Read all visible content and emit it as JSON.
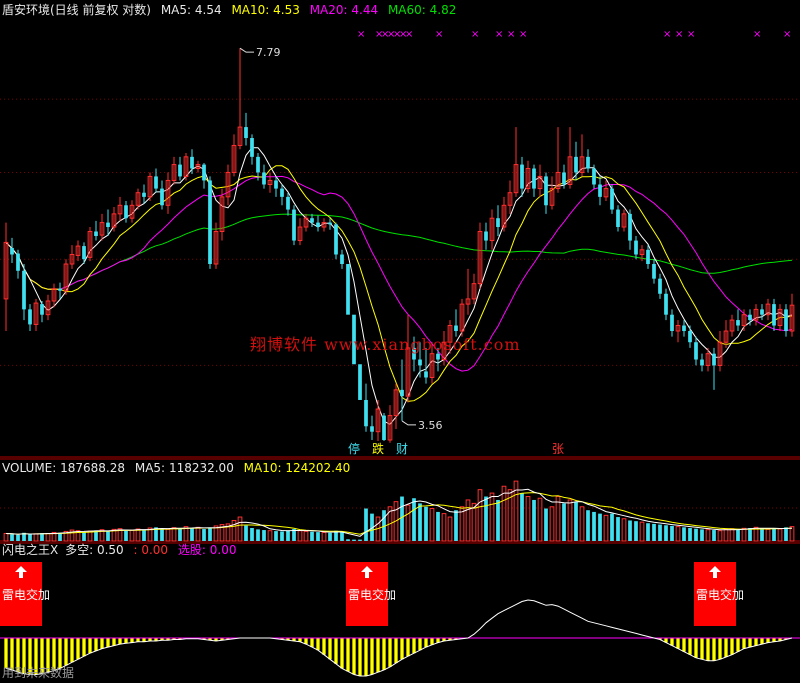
{
  "header": {
    "title": "盾安环境(日线 前复权 对数)",
    "ma5_label": "MA5:",
    "ma5_value": "4.54",
    "ma10_label": "MA10:",
    "ma10_value": "4.53",
    "ma20_label": "MA20:",
    "ma20_value": "4.44",
    "ma60_label": "MA60:",
    "ma60_value": "4.82"
  },
  "volume_header": {
    "label": "VOLUME:",
    "value": "187688.28",
    "ma5_label": "MA5:",
    "ma5_value": "118232.00",
    "ma10_label": "MA10:",
    "ma10_value": "124202.40"
  },
  "indicator_header": {
    "name": "闪电之王X",
    "duokong_label": "多空:",
    "duokong_value": "0.50",
    "extra_value": ": 0.00",
    "xuangu_label": "选股:",
    "xuangu_value": "0.00"
  },
  "watermark": "翔博软件  www.xiangbosoft.com",
  "footer": "用到未来数据",
  "colors": {
    "up": "#ff3030",
    "down": "#40e0f0",
    "ma5": "#ffffff",
    "ma10": "#ffff00",
    "ma20": "#ff00ff",
    "ma60": "#00e000",
    "grid": "#7a0000",
    "signal_box": "#ff0000",
    "histogram": "#ffff00"
  },
  "chart_data": [
    {
      "type": "candlestick",
      "panel": "price",
      "y_scale": "log",
      "ylim": [
        3.3,
        8.3
      ],
      "annotations": [
        {
          "text": "7.79",
          "bar": 39,
          "price": 7.79
        },
        {
          "text": "3.56",
          "bar": 66,
          "price": 3.56
        }
      ],
      "markers": [
        {
          "text": "停",
          "bar": 58,
          "color": "#40e0f0"
        },
        {
          "text": "跌",
          "bar": 62,
          "color": "#ffff00"
        },
        {
          "text": "财",
          "bar": 66,
          "color": "#40e0f0"
        },
        {
          "text": "张",
          "bar": 92,
          "color": "#ff3030"
        }
      ],
      "top_marks": {
        "symbol": "×",
        "bars": [
          59,
          62,
          63,
          64,
          65,
          66,
          67,
          72,
          78,
          82,
          84,
          86,
          110,
          112,
          114,
          125,
          130
        ]
      },
      "candles": [
        [
          4.6,
          5.18,
          4.3,
          5.4
        ],
        [
          5.12,
          5.05,
          4.96,
          5.23
        ],
        [
          5.06,
          4.88,
          4.8,
          5.1
        ],
        [
          4.88,
          4.5,
          4.4,
          4.95
        ],
        [
          4.5,
          4.36,
          4.3,
          4.55
        ],
        [
          4.36,
          4.56,
          4.3,
          4.6
        ],
        [
          4.55,
          4.45,
          4.38,
          4.58
        ],
        [
          4.45,
          4.58,
          4.4,
          4.64
        ],
        [
          4.58,
          4.7,
          4.52,
          4.75
        ],
        [
          4.7,
          4.68,
          4.6,
          4.76
        ],
        [
          4.68,
          4.95,
          4.64,
          5.0
        ],
        [
          4.95,
          5.05,
          4.9,
          5.15
        ],
        [
          5.04,
          5.14,
          4.98,
          5.2
        ],
        [
          5.14,
          5.0,
          4.95,
          5.18
        ],
        [
          5.02,
          5.3,
          4.98,
          5.35
        ],
        [
          5.3,
          5.25,
          5.2,
          5.42
        ],
        [
          5.26,
          5.4,
          5.2,
          5.5
        ],
        [
          5.4,
          5.35,
          5.25,
          5.55
        ],
        [
          5.35,
          5.5,
          5.3,
          5.58
        ],
        [
          5.5,
          5.6,
          5.42,
          5.7
        ],
        [
          5.6,
          5.45,
          5.4,
          5.65
        ],
        [
          5.45,
          5.6,
          5.4,
          5.66
        ],
        [
          5.6,
          5.75,
          5.55,
          5.8
        ],
        [
          5.75,
          5.7,
          5.62,
          5.85
        ],
        [
          5.7,
          5.95,
          5.65,
          6.0
        ],
        [
          5.95,
          5.8,
          5.75,
          6.05
        ],
        [
          5.8,
          5.6,
          5.55,
          5.9
        ],
        [
          5.6,
          5.9,
          5.5,
          6.0
        ],
        [
          5.9,
          6.1,
          5.85,
          6.2
        ],
        [
          6.1,
          5.95,
          5.9,
          6.2
        ],
        [
          5.95,
          6.2,
          5.9,
          6.25
        ],
        [
          6.2,
          6.05,
          5.98,
          6.3
        ],
        [
          6.05,
          6.1,
          6.0,
          6.15
        ],
        [
          6.1,
          5.9,
          5.8,
          6.12
        ],
        [
          5.9,
          4.95,
          4.9,
          5.95
        ],
        [
          4.95,
          5.3,
          4.9,
          5.4
        ],
        [
          5.3,
          5.7,
          5.2,
          5.8
        ],
        [
          5.7,
          6.0,
          5.6,
          6.1
        ],
        [
          6.0,
          6.35,
          5.95,
          6.5
        ],
        [
          6.35,
          6.6,
          6.3,
          7.79
        ],
        [
          6.6,
          6.45,
          6.35,
          6.8
        ],
        [
          6.45,
          6.2,
          6.1,
          6.5
        ],
        [
          6.2,
          6.0,
          5.9,
          6.25
        ],
        [
          6.0,
          5.85,
          5.8,
          6.1
        ],
        [
          5.85,
          5.9,
          5.75,
          6.0
        ],
        [
          5.9,
          5.8,
          5.7,
          5.95
        ],
        [
          5.8,
          5.7,
          5.6,
          5.85
        ],
        [
          5.7,
          5.55,
          5.48,
          5.75
        ],
        [
          5.55,
          5.2,
          5.15,
          5.6
        ],
        [
          5.2,
          5.35,
          5.15,
          5.45
        ],
        [
          5.35,
          5.45,
          5.3,
          5.5
        ],
        [
          5.45,
          5.4,
          5.35,
          5.5
        ],
        [
          5.4,
          5.35,
          5.3,
          5.48
        ],
        [
          5.35,
          5.4,
          5.3,
          5.45
        ],
        [
          5.4,
          5.38,
          5.32,
          5.45
        ],
        [
          5.38,
          5.05,
          5.0,
          5.4
        ],
        [
          5.05,
          4.95,
          4.9,
          5.1
        ],
        [
          4.95,
          4.45,
          4.45,
          4.45
        ],
        [
          4.45,
          4.01,
          4.01,
          4.01
        ],
        [
          4.01,
          3.72,
          3.72,
          3.72
        ],
        [
          3.72,
          3.52,
          3.48,
          3.85
        ],
        [
          3.52,
          3.48,
          3.42,
          3.6
        ],
        [
          3.48,
          3.65,
          3.4,
          3.72
        ],
        [
          3.6,
          3.42,
          3.38,
          3.62
        ],
        [
          3.42,
          3.6,
          3.4,
          3.68
        ],
        [
          3.6,
          3.8,
          3.5,
          3.85
        ],
        [
          3.8,
          3.75,
          3.56,
          4.05
        ],
        [
          3.75,
          4.15,
          3.7,
          4.45
        ],
        [
          4.15,
          4.05,
          3.95,
          4.25
        ],
        [
          4.05,
          4.0,
          3.9,
          4.2
        ],
        [
          3.95,
          3.9,
          3.85,
          4.15
        ],
        [
          3.9,
          4.1,
          3.85,
          4.2
        ],
        [
          4.1,
          4.05,
          3.95,
          4.15
        ],
        [
          4.05,
          4.2,
          4.0,
          4.3
        ],
        [
          4.2,
          4.35,
          4.1,
          4.4
        ],
        [
          4.35,
          4.3,
          4.25,
          4.5
        ],
        [
          4.3,
          4.55,
          4.25,
          4.6
        ],
        [
          4.55,
          4.6,
          4.45,
          4.9
        ],
        [
          4.6,
          4.75,
          4.55,
          4.85
        ],
        [
          4.75,
          5.3,
          4.7,
          5.4
        ],
        [
          5.3,
          5.2,
          5.1,
          5.4
        ],
        [
          5.2,
          5.45,
          5.1,
          5.55
        ],
        [
          5.45,
          5.35,
          5.25,
          5.6
        ],
        [
          5.35,
          5.6,
          5.3,
          5.7
        ],
        [
          5.6,
          5.75,
          5.5,
          5.9
        ],
        [
          5.75,
          6.1,
          5.7,
          6.6
        ],
        [
          6.1,
          5.8,
          5.7,
          6.2
        ],
        [
          5.8,
          6.05,
          5.75,
          6.15
        ],
        [
          6.05,
          5.8,
          5.7,
          6.1
        ],
        [
          5.8,
          5.95,
          5.7,
          6.1
        ],
        [
          5.95,
          5.6,
          5.5,
          6.0
        ],
        [
          5.6,
          5.8,
          5.55,
          5.95
        ],
        [
          5.8,
          6.0,
          5.75,
          6.6
        ],
        [
          6.0,
          5.85,
          5.8,
          6.1
        ],
        [
          5.85,
          6.2,
          5.8,
          6.6
        ],
        [
          6.2,
          6.0,
          5.9,
          6.4
        ],
        [
          6.0,
          6.2,
          5.95,
          6.5
        ],
        [
          6.2,
          6.05,
          6.0,
          6.3
        ],
        [
          6.05,
          5.85,
          5.8,
          6.1
        ],
        [
          5.85,
          5.7,
          5.6,
          5.95
        ],
        [
          5.7,
          5.8,
          5.65,
          5.9
        ],
        [
          5.8,
          5.55,
          5.5,
          5.85
        ],
        [
          5.55,
          5.35,
          5.3,
          5.6
        ],
        [
          5.35,
          5.5,
          5.3,
          5.55
        ],
        [
          5.5,
          5.2,
          5.1,
          5.55
        ],
        [
          5.2,
          5.05,
          5.0,
          5.25
        ],
        [
          5.05,
          5.1,
          4.98,
          5.15
        ],
        [
          5.1,
          4.95,
          4.9,
          5.15
        ],
        [
          4.95,
          4.8,
          4.75,
          5.0
        ],
        [
          4.8,
          4.65,
          4.6,
          4.85
        ],
        [
          4.65,
          4.45,
          4.4,
          4.7
        ],
        [
          4.45,
          4.3,
          4.25,
          4.5
        ],
        [
          4.3,
          4.35,
          4.2,
          4.4
        ],
        [
          4.35,
          4.3,
          4.25,
          4.4
        ],
        [
          4.3,
          4.2,
          4.15,
          4.35
        ],
        [
          4.2,
          4.05,
          4.0,
          4.25
        ],
        [
          4.05,
          4.0,
          3.95,
          4.1
        ],
        [
          4.0,
          4.1,
          3.95,
          4.15
        ],
        [
          4.1,
          4.0,
          3.8,
          4.15
        ],
        [
          4.0,
          4.2,
          3.95,
          4.3
        ],
        [
          4.2,
          4.3,
          4.15,
          4.4
        ],
        [
          4.3,
          4.4,
          4.25,
          4.45
        ],
        [
          4.4,
          4.35,
          4.3,
          4.5
        ],
        [
          4.35,
          4.45,
          4.3,
          4.5
        ],
        [
          4.45,
          4.4,
          4.35,
          4.5
        ],
        [
          4.4,
          4.5,
          4.35,
          4.55
        ],
        [
          4.5,
          4.45,
          4.4,
          4.55
        ],
        [
          4.45,
          4.55,
          4.4,
          4.6
        ],
        [
          4.55,
          4.35,
          4.3,
          4.6
        ],
        [
          4.35,
          4.5,
          4.3,
          4.55
        ],
        [
          4.5,
          4.3,
          4.25,
          4.55
        ],
        [
          4.3,
          4.54,
          4.25,
          4.65
        ]
      ]
    },
    {
      "type": "bar",
      "panel": "volume",
      "ylim": [
        0,
        190000
      ],
      "values": [
        22000,
        20000,
        18000,
        24000,
        19000,
        21000,
        23000,
        22000,
        25000,
        24000,
        28000,
        32000,
        30000,
        26000,
        29000,
        31000,
        33000,
        28000,
        34000,
        36000,
        30000,
        32000,
        35000,
        33000,
        38000,
        40000,
        36000,
        34000,
        39000,
        37000,
        42000,
        38000,
        40000,
        35000,
        38000,
        44000,
        48000,
        50000,
        60000,
        70000,
        45000,
        38000,
        34000,
        32000,
        30000,
        29000,
        28000,
        31000,
        35000,
        30000,
        28000,
        27000,
        26000,
        25000,
        24000,
        30000,
        26000,
        5000,
        4000,
        4000,
        95000,
        80000,
        70000,
        90000,
        100000,
        115000,
        130000,
        105000,
        125000,
        110000,
        100000,
        95000,
        85000,
        80000,
        70000,
        90000,
        100000,
        120000,
        110000,
        150000,
        130000,
        140000,
        120000,
        160000,
        150000,
        175000,
        140000,
        130000,
        120000,
        125000,
        95000,
        100000,
        130000,
        110000,
        120000,
        115000,
        100000,
        90000,
        85000,
        80000,
        75000,
        80000,
        70000,
        65000,
        60000,
        58000,
        55000,
        52000,
        50000,
        48000,
        46000,
        44000,
        42000,
        40000,
        38000,
        36000,
        34000,
        33000,
        32000,
        30000,
        34000,
        36000,
        35000,
        37000,
        38000,
        40000,
        36000,
        34000,
        38000,
        35000,
        40000,
        42000
      ],
      "ma5": [
        118232.0
      ],
      "ma10": [
        124202.4
      ]
    },
    {
      "type": "area",
      "panel": "indicator",
      "zero_line": 0.5,
      "signals": [
        {
          "label": "雷电交加",
          "bar": 0
        },
        {
          "label": "雷电交加",
          "bar": 60
        },
        {
          "label": "雷电交加",
          "bar": 118
        }
      ],
      "values": [
        0.1,
        0.08,
        0.05,
        0.03,
        0.02,
        0.02,
        0.03,
        0.05,
        0.07,
        0.1,
        0.14,
        0.18,
        0.22,
        0.26,
        0.3,
        0.33,
        0.36,
        0.38,
        0.4,
        0.42,
        0.43,
        0.44,
        0.45,
        0.45,
        0.46,
        0.46,
        0.47,
        0.47,
        0.48,
        0.48,
        0.49,
        0.49,
        0.49,
        0.48,
        0.47,
        0.46,
        0.47,
        0.48,
        0.49,
        0.5,
        0.5,
        0.5,
        0.5,
        0.5,
        0.5,
        0.49,
        0.48,
        0.47,
        0.46,
        0.45,
        0.42,
        0.38,
        0.34,
        0.28,
        0.22,
        0.16,
        0.1,
        0.06,
        0.02,
        0.0,
        0.0,
        0.02,
        0.05,
        0.08,
        0.12,
        0.17,
        0.22,
        0.26,
        0.3,
        0.34,
        0.38,
        0.41,
        0.44,
        0.46,
        0.47,
        0.48,
        0.49,
        0.5,
        0.55,
        0.62,
        0.7,
        0.76,
        0.82,
        0.86,
        0.9,
        0.94,
        0.98,
        1.0,
        0.99,
        0.96,
        0.93,
        0.94,
        0.92,
        0.88,
        0.84,
        0.8,
        0.76,
        0.72,
        0.7,
        0.68,
        0.66,
        0.64,
        0.62,
        0.6,
        0.58,
        0.56,
        0.54,
        0.52,
        0.5,
        0.48,
        0.44,
        0.4,
        0.36,
        0.32,
        0.28,
        0.24,
        0.22,
        0.2,
        0.2,
        0.22,
        0.25,
        0.28,
        0.32,
        0.36,
        0.38,
        0.4,
        0.42,
        0.44,
        0.45,
        0.46,
        0.48,
        0.5
      ]
    }
  ]
}
